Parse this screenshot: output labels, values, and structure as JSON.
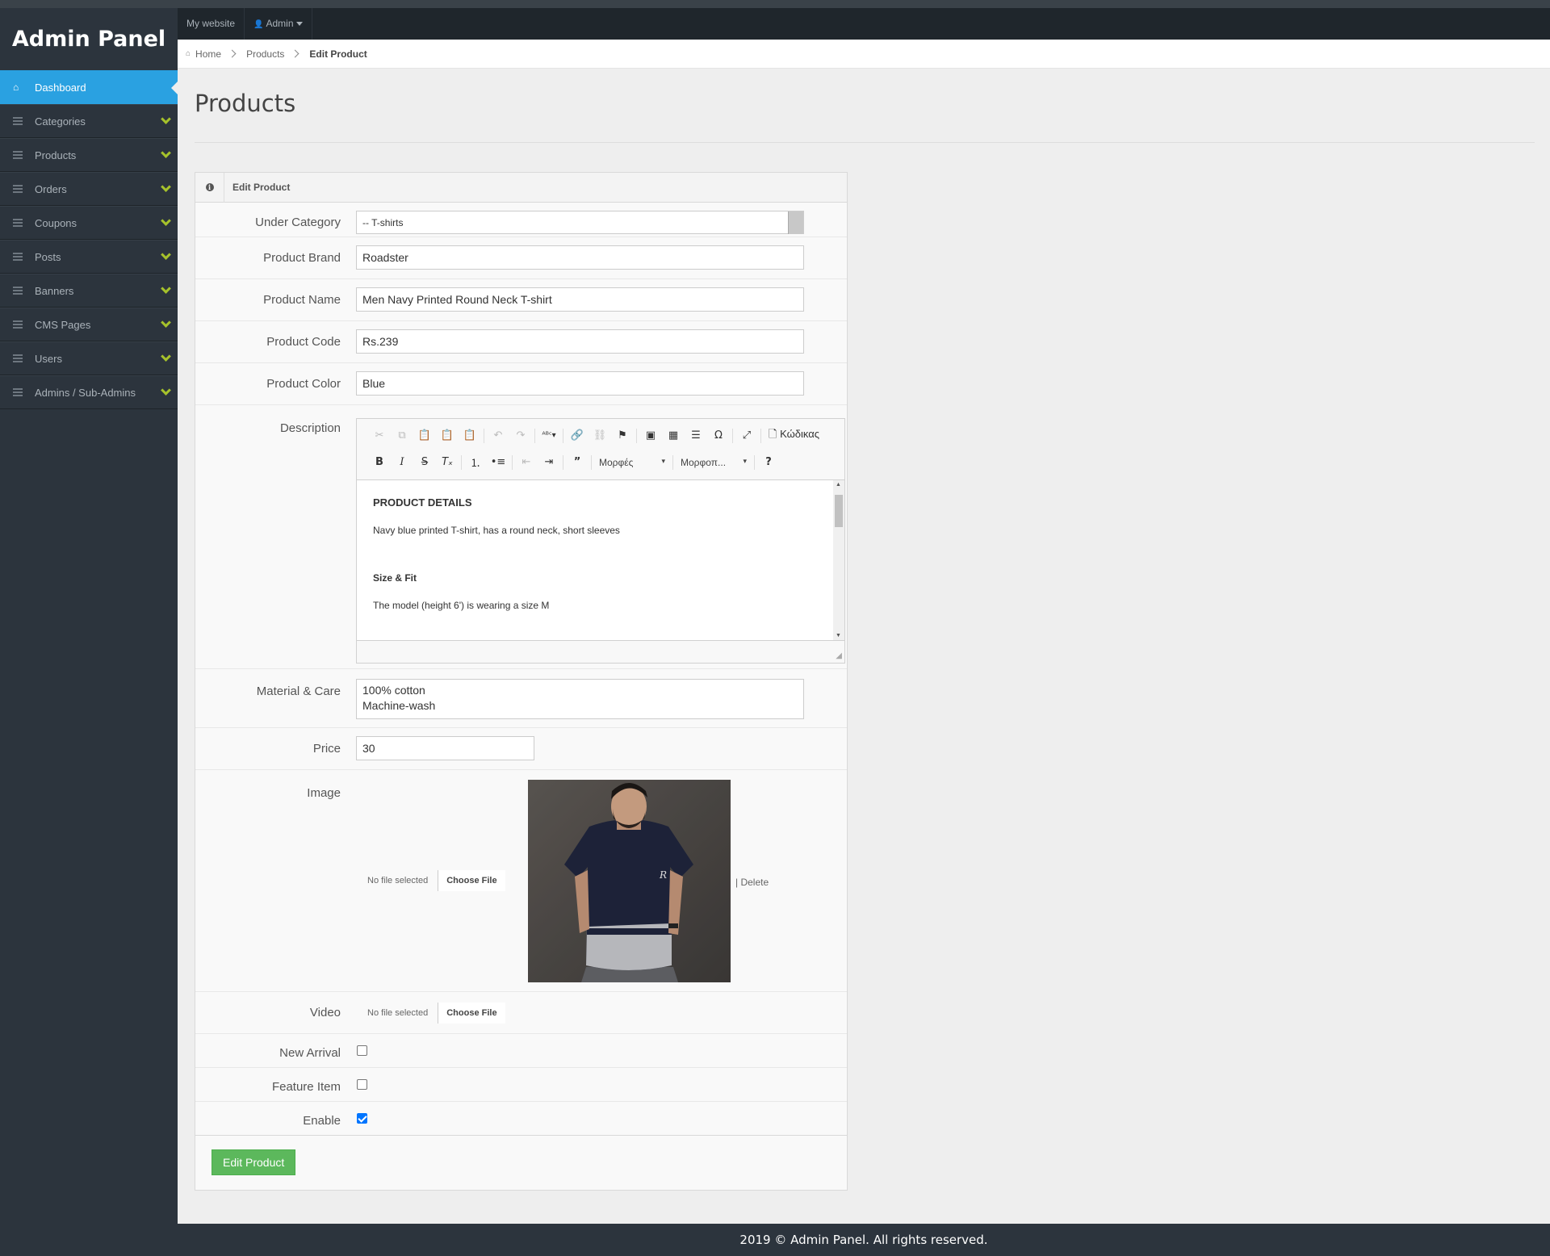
{
  "brand": "Admin Panel",
  "topnav": {
    "site_link": "My website",
    "admin_menu": "Admin"
  },
  "sidebar": {
    "items": [
      {
        "label": "Dashboard"
      },
      {
        "label": "Categories"
      },
      {
        "label": "Products"
      },
      {
        "label": "Orders"
      },
      {
        "label": "Coupons"
      },
      {
        "label": "Posts"
      },
      {
        "label": "Banners"
      },
      {
        "label": "CMS Pages"
      },
      {
        "label": "Users"
      },
      {
        "label": "Admins / Sub-Admins"
      }
    ]
  },
  "breadcrumb": {
    "home": "Home",
    "section": "Products",
    "current": "Edit Product"
  },
  "page_title": "Products",
  "form": {
    "panel_title": "Edit Product",
    "category": {
      "label": "Under Category",
      "value": "-- T-shirts"
    },
    "brand": {
      "label": "Product Brand",
      "value": "Roadster"
    },
    "name": {
      "label": "Product Name",
      "value": "Men Navy Printed Round Neck T-shirt"
    },
    "code": {
      "label": "Product Code",
      "value": "Rs.239"
    },
    "color": {
      "label": "Product Color",
      "value": "Blue"
    },
    "description": {
      "label": "Description",
      "toolbar": {
        "source": "Κώδικας",
        "styles": "Μορφές",
        "format": "Μορφοπ..."
      },
      "heading1": "PRODUCT DETAILS",
      "para1": "Navy blue printed T-shirt, has a round neck, short sleeves",
      "heading2": "Size & Fit",
      "para2": "The model (height 6') is wearing a size M"
    },
    "material": {
      "label": "Material & Care",
      "line1": "100% cotton",
      "line2": "Machine-wash"
    },
    "price": {
      "label": "Price",
      "value": "30"
    },
    "image": {
      "label": "Image",
      "no_file": "No file selected",
      "choose": "Choose File",
      "delete": "| Delete"
    },
    "video": {
      "label": "Video",
      "no_file": "No file selected",
      "choose": "Choose File"
    },
    "new_arrival": {
      "label": "New Arrival",
      "checked": false
    },
    "feature_item": {
      "label": "Feature Item",
      "checked": false
    },
    "enable": {
      "label": "Enable",
      "checked": true
    },
    "submit": "Edit Product"
  },
  "footer": "2019 © Admin Panel. All rights reserved.",
  "colors": {
    "accent": "#2aa1e1",
    "sidebar": "#2c343d",
    "chevron": "#a6c22b",
    "submit": "#5cb85c"
  }
}
